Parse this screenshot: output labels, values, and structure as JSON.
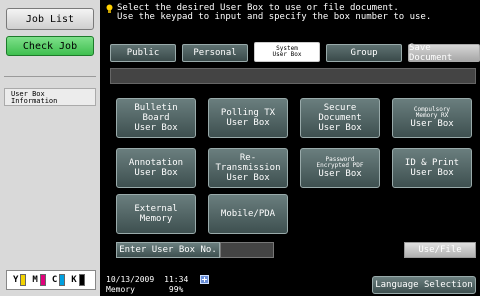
{
  "left": {
    "job_list": "Job List",
    "check_job": "Check Job",
    "user_box_info": [
      "User Box",
      "Information"
    ]
  },
  "toner": [
    {
      "letter": "Y",
      "color": "#f2d200"
    },
    {
      "letter": "M",
      "color": "#e0007a"
    },
    {
      "letter": "C",
      "color": "#00a0e0"
    },
    {
      "letter": "K",
      "color": "#000000"
    }
  ],
  "message": {
    "line1": "Select the desired User Box to use or file document.",
    "line2": "Use the keypad to input and specify the box number to use."
  },
  "tabs": {
    "public": "Public",
    "personal": "Personal",
    "system": [
      "System",
      "User Box"
    ],
    "group": "Group",
    "save_document": "Save Document"
  },
  "tiles": {
    "bulletin": [
      "Bulletin Board",
      "User Box"
    ],
    "polling": [
      "Polling TX",
      "User Box"
    ],
    "secure": [
      "Secure Document",
      "User Box"
    ],
    "compulsory": [
      "Compulsory",
      "Memory RX",
      "User Box"
    ],
    "annotation": [
      "Annotation",
      "User Box"
    ],
    "retransmission": [
      "Re-Transmission",
      "User Box"
    ],
    "encrypted": [
      "Password",
      "Encrypted PDF",
      "User Box"
    ],
    "idprint": [
      "ID & Print",
      "User Box"
    ],
    "external": "External Memory",
    "mobile": "Mobile/PDA"
  },
  "actions": {
    "enter_box": "Enter User Box No.",
    "use_file": "Use/File",
    "language": "Language Selection"
  },
  "status": {
    "date": "10/13/2009",
    "time": "11:34",
    "memory_label": "Memory",
    "memory_value": "99%"
  }
}
